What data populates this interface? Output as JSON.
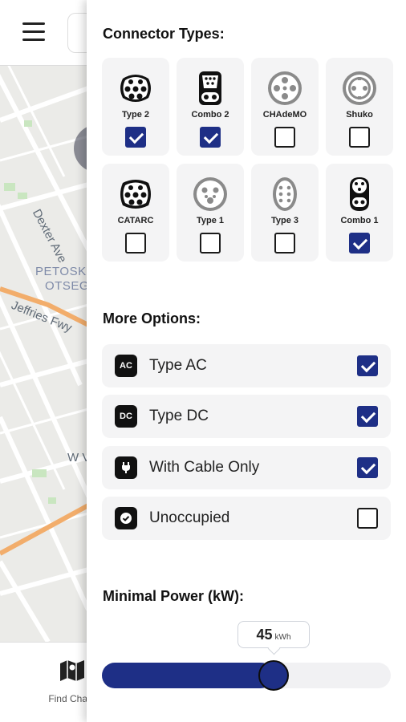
{
  "map": {
    "labels": {
      "street1": "Dexter Ave",
      "area1": "PETOSKE",
      "area2": "OTSEGO",
      "freeway": "Jeffries Fwy",
      "street2": "W V"
    },
    "bottom_nav": {
      "find_label": "Find Charg",
      "icon": "map-icon"
    }
  },
  "filters": {
    "connector_title": "Connector Types:",
    "connectors": [
      {
        "label": "Type 2",
        "checked": true,
        "icon": "type2-connector-icon"
      },
      {
        "label": "Combo 2",
        "checked": true,
        "icon": "combo2-connector-icon"
      },
      {
        "label": "CHAdeMO",
        "checked": false,
        "icon": "chademo-connector-icon"
      },
      {
        "label": "Shuko",
        "checked": false,
        "icon": "shuko-connector-icon"
      },
      {
        "label": "CATARC",
        "checked": false,
        "icon": "catarc-connector-icon"
      },
      {
        "label": "Type 1",
        "checked": false,
        "icon": "type1-connector-icon"
      },
      {
        "label": "Type 3",
        "checked": false,
        "icon": "type3-connector-icon"
      },
      {
        "label": "Combo 1",
        "checked": true,
        "icon": "combo1-connector-icon"
      }
    ],
    "options_title": "More Options:",
    "options": [
      {
        "badge": "AC",
        "label": "Type AC",
        "checked": true
      },
      {
        "badge": "DC",
        "label": "Type DC",
        "checked": true
      },
      {
        "badge": "",
        "label": "With Cable Only",
        "checked": true,
        "icon": "plug-icon"
      },
      {
        "badge": "",
        "label": "Unoccupied",
        "checked": false,
        "icon": "check-circle-icon"
      }
    ],
    "power_title": "Minimal Power (kW):",
    "power": {
      "value": "45",
      "unit": "kWh",
      "fraction": 0.595
    },
    "colors": {
      "accent": "#1e2f86",
      "card_bg": "#f4f4f5"
    }
  }
}
